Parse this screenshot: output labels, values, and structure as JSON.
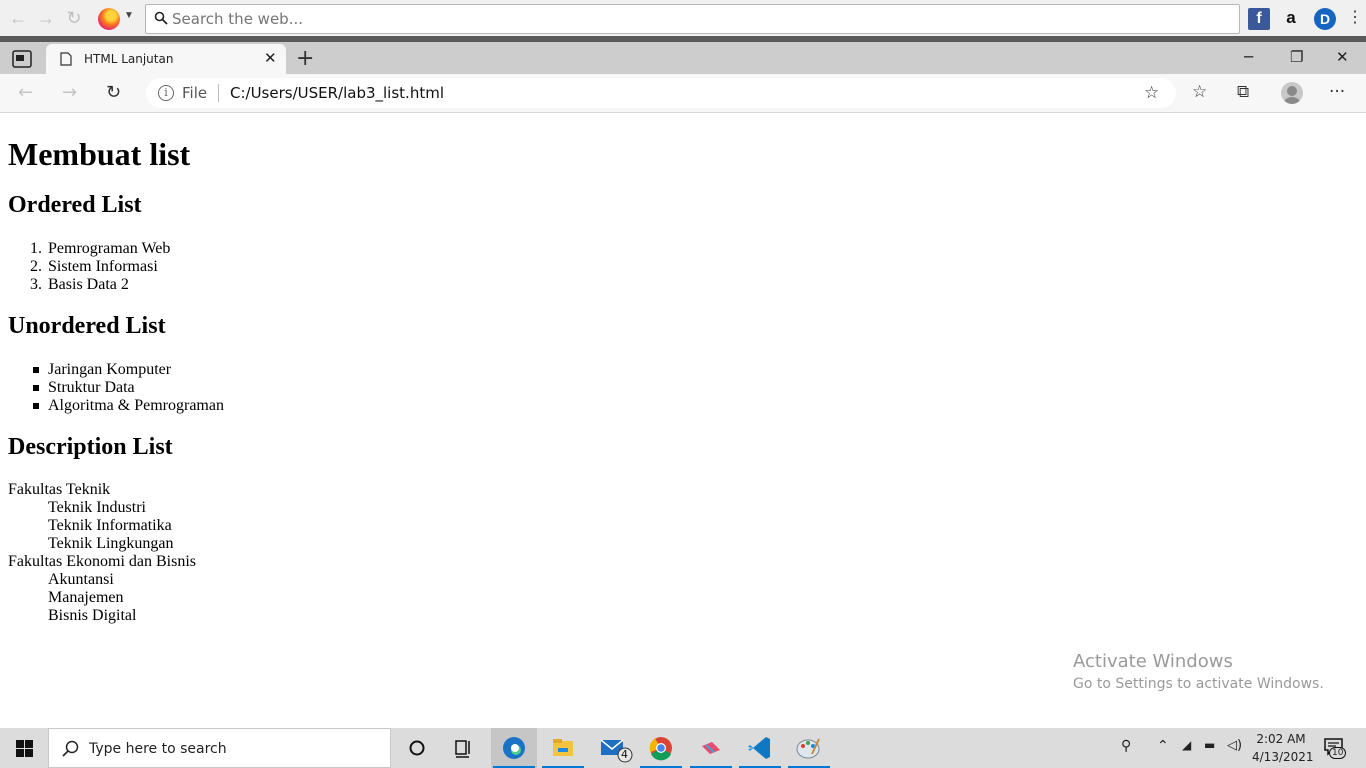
{
  "outer_toolbar": {
    "search_placeholder": "Search the web...",
    "extensions": {
      "facebook": "f",
      "amazon": "a",
      "d_ext": "D"
    }
  },
  "edge": {
    "tab": {
      "title": "HTML Lanjutan"
    },
    "address": {
      "scheme": "File",
      "url": "C:/Users/USER/lab3_list.html"
    }
  },
  "page": {
    "h1": "Membuat list",
    "ordered": {
      "heading": "Ordered List",
      "items": [
        "Pemrograman Web",
        "Sistem Informasi",
        "Basis Data 2"
      ]
    },
    "unordered": {
      "heading": "Unordered List",
      "items": [
        "Jaringan Komputer",
        "Struktur Data",
        "Algoritma & Pemrograman"
      ]
    },
    "description": {
      "heading": "Description List",
      "groups": [
        {
          "term": "Fakultas Teknik",
          "defs": [
            "Teknik Industri",
            "Teknik Informatika",
            "Teknik Lingkungan"
          ]
        },
        {
          "term": "Fakultas Ekonomi dan Bisnis",
          "defs": [
            "Akuntansi",
            "Manajemen",
            "Bisnis Digital"
          ]
        }
      ]
    }
  },
  "watermark": {
    "line1": "Activate Windows",
    "line2": "Go to Settings to activate Windows."
  },
  "taskbar": {
    "search_placeholder": "Type here to search",
    "mail_badge": "4",
    "notification_count": "10",
    "time": "2:02 AM",
    "date": "4/13/2021"
  },
  "colors": {
    "edge_accent": "#0078d4",
    "tabstrip": "#cdcdcd",
    "taskbar": "#dcdcdc"
  }
}
